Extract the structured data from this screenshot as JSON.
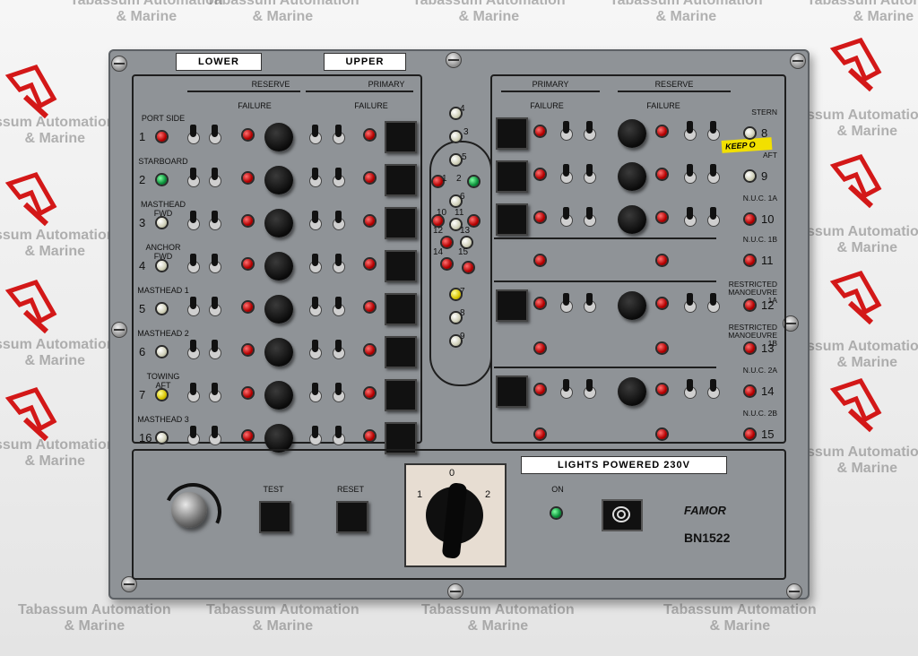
{
  "watermark": {
    "line1": "Tabassum Automation",
    "line2": "& Marine",
    "line1_short": "ssum Automation",
    "line1_alt": "Tabassum Automation",
    "footer_line1": "Tabassum Automation",
    "footer_line2": "& Marine"
  },
  "panel": {
    "tabs": {
      "lower": "LOWER",
      "upper": "UPPER"
    },
    "left": {
      "reserve": "RESERVE",
      "primary": "PRIMARY",
      "failure": "FAILURE",
      "rows": [
        {
          "name": "PORT SIDE",
          "num": "1",
          "led": "red"
        },
        {
          "name": "STARBOARD",
          "num": "2",
          "led": "green"
        },
        {
          "name": "MASTHEAD\nFWD",
          "num": "3",
          "led": "clear"
        },
        {
          "name": "ANCHOR\nFWD",
          "num": "4",
          "led": "clear"
        },
        {
          "name": "MASTHEAD 1",
          "num": "5",
          "led": "clear"
        },
        {
          "name": "MASTHEAD 2",
          "num": "6",
          "led": "clear"
        },
        {
          "name": "TOWING\nAFT",
          "num": "7",
          "led": "yellow"
        },
        {
          "name": "MASTHEAD 3",
          "num": "16",
          "led": "clear"
        }
      ]
    },
    "center": {
      "labels": [
        "4",
        "3",
        "5",
        "1",
        "2",
        "6",
        "10",
        "11",
        "12",
        "13",
        "14",
        "15",
        "7",
        "8",
        "9"
      ]
    },
    "right": {
      "primary": "PRIMARY",
      "reserve": "RESERVE",
      "failure": "FAILURE",
      "rows": [
        {
          "name": "STERN",
          "num": "8"
        },
        {
          "name": "AFT",
          "num": "9"
        },
        {
          "name": "N.U.C. 1A",
          "num": "10"
        },
        {
          "name": "N.U.C. 1B",
          "num": "11"
        },
        {
          "name": "RESTRICTED\nMANOEUVRE\n1A",
          "num": "12"
        },
        {
          "name": "RESTRICTED\nMANOEUVRE\n1B",
          "num": "13"
        },
        {
          "name": "N.U.C. 2A",
          "num": "14"
        },
        {
          "name": "N.U.C. 2B",
          "num": "15"
        }
      ],
      "sticker": "KEEP O"
    },
    "bottom": {
      "lights_powered": "LIGHTS POWERED 230V",
      "test": "TEST",
      "reset": "RESET",
      "selector": {
        "pos0": "0",
        "pos1": "1",
        "pos2": "2"
      },
      "on": "ON",
      "brand": "FAMOR",
      "model": "BN1522"
    }
  },
  "colors": {
    "panel": "#8f9397",
    "led_red": "#b40000",
    "led_green": "#0b8f3a"
  }
}
